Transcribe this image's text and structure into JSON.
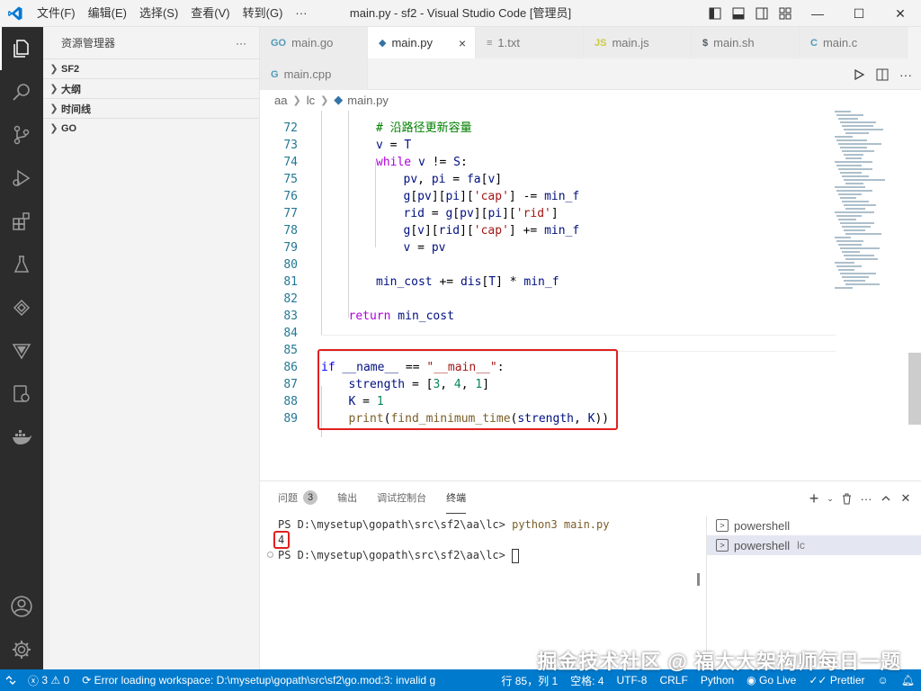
{
  "titlebar": {
    "menus": [
      "文件(F)",
      "编辑(E)",
      "选择(S)",
      "查看(V)",
      "转到(G)",
      "···"
    ],
    "title": "main.py - sf2 - Visual Studio Code [管理员]",
    "window_controls": {
      "minimize": "—",
      "maximize": "☐",
      "close": "✕"
    }
  },
  "sidebar": {
    "header": "资源管理器",
    "more": "···",
    "sections": [
      "SF2",
      "大纲",
      "时间线",
      "GO"
    ]
  },
  "tabs": [
    {
      "label": "main.go",
      "icon": "GO",
      "icon_color": "#519aba"
    },
    {
      "label": "main.py",
      "icon": "◆",
      "icon_color": "#3572a5",
      "close": "×"
    },
    {
      "label": "1.txt",
      "icon": "≡",
      "icon_color": "#888888"
    },
    {
      "label": "main.js",
      "icon": "JS",
      "icon_color": "#cbcb41"
    },
    {
      "label": "main.sh",
      "icon": "$",
      "icon_color": "#4d5a5e"
    },
    {
      "label": "main.c",
      "icon": "C",
      "icon_color": "#519aba"
    }
  ],
  "tabs_row2": [
    {
      "label": "main.cpp",
      "icon": "G",
      "icon_color": "#519aba"
    }
  ],
  "breadcrumb": [
    "aa",
    "lc",
    "main.py"
  ],
  "code_lines": [
    {
      "n": "72",
      "html": "<span class=\"cm\"># 沿路径更新容量</span>"
    },
    {
      "n": "73",
      "html": "<span class=\"vr\">v</span> = <span class=\"vr\">T</span>"
    },
    {
      "n": "74",
      "html": "<span class=\"kw2\">while</span> <span class=\"vr\">v</span> != <span class=\"vr\">S</span>:"
    },
    {
      "n": "75",
      "html": "<span class=\"vr\">pv</span>, <span class=\"vr\">pi</span> = <span class=\"vr\">fa</span>[<span class=\"vr\">v</span>]"
    },
    {
      "n": "76",
      "html": "<span class=\"vr\">g</span>[<span class=\"vr\">pv</span>][<span class=\"vr\">pi</span>][<span class=\"st\">'cap'</span>] -= <span class=\"vr\">min_f</span>"
    },
    {
      "n": "77",
      "html": "<span class=\"vr\">rid</span> = <span class=\"vr\">g</span>[<span class=\"vr\">pv</span>][<span class=\"vr\">pi</span>][<span class=\"st\">'rid'</span>]"
    },
    {
      "n": "78",
      "html": "<span class=\"vr\">g</span>[<span class=\"vr\">v</span>][<span class=\"vr\">rid</span>][<span class=\"st\">'cap'</span>] += <span class=\"vr\">min_f</span>"
    },
    {
      "n": "79",
      "html": "<span class=\"vr\">v</span> = <span class=\"vr\">pv</span>"
    },
    {
      "n": "80",
      "html": ""
    },
    {
      "n": "81",
      "html": "<span class=\"vr\">min_cost</span> += <span class=\"vr\">dis</span>[<span class=\"vr\">T</span>] * <span class=\"vr\">min_f</span>"
    },
    {
      "n": "82",
      "html": ""
    },
    {
      "n": "83",
      "html": "<span class=\"kw2\">return</span> <span class=\"vr\">min_cost</span>"
    },
    {
      "n": "84",
      "html": ""
    },
    {
      "n": "85",
      "html": ""
    },
    {
      "n": "86",
      "html": "<span class=\"kw\">if</span> <span class=\"vr\">__name__</span> == <span class=\"st\">\"__main__\"</span>:"
    },
    {
      "n": "87",
      "html": "<span class=\"vr\">strength</span> = [<span class=\"nm\">3</span>, <span class=\"nm\">4</span>, <span class=\"nm\">1</span>]"
    },
    {
      "n": "88",
      "html": "<span class=\"vr\">K</span> = <span class=\"nm\">1</span>"
    },
    {
      "n": "89",
      "html": "<span class=\"fn\">print</span>(<span class=\"fn\">find_minimum_time</span>(<span class=\"vr\">strength</span>, <span class=\"vr\">K</span>))"
    }
  ],
  "panel": {
    "tabs": [
      "问题",
      "输出",
      "调试控制台",
      "终端"
    ],
    "problems_count": "3",
    "terminal": {
      "prompt1": "PS D:\\mysetup\\gopath\\src\\sf2\\aa\\lc> ",
      "command": "python3 main.py",
      "output": "4",
      "prompt2": "PS D:\\mysetup\\gopath\\src\\sf2\\aa\\lc> "
    },
    "terminals": [
      {
        "label": "powershell",
        "sub": ""
      },
      {
        "label": "powershell",
        "sub": "lc"
      }
    ]
  },
  "statusbar": {
    "errors": "3",
    "warnings": "0",
    "message": "Error loading workspace: D:\\mysetup\\gopath\\src\\sf2\\go.mod:3: invalid g",
    "position": "行 85，列 1",
    "spaces": "空格: 4",
    "encoding": "UTF-8",
    "eol": "CRLF",
    "language": "Python",
    "golive": "Go Live",
    "prettier": "Prettier"
  },
  "watermark": "掘金技术社区 @ 福大大架构师每日一题",
  "colors": {
    "accent": "#007acc",
    "activitybar": "#2c2c2c",
    "highlight": "#e02020"
  }
}
